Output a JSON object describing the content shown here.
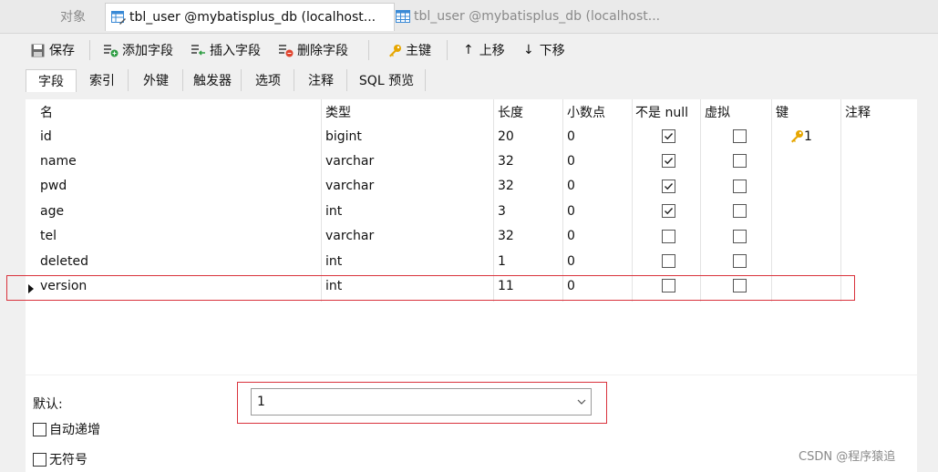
{
  "window_tabs": [
    {
      "label": "对象"
    },
    {
      "label": "tbl_user @mybatisplus_db (localhost..."
    },
    {
      "label": "tbl_user @mybatisplus_db (localhost..."
    }
  ],
  "toolbar": {
    "save": "保存",
    "add_field": "添加字段",
    "insert_field": "插入字段",
    "delete_field": "删除字段",
    "primary_key": "主键",
    "move_up": "上移",
    "move_down": "下移"
  },
  "sub_tabs": [
    "字段",
    "索引",
    "外键",
    "触发器",
    "选项",
    "注释",
    "SQL 预览"
  ],
  "columns": [
    "名",
    "类型",
    "长度",
    "小数点",
    "不是 null",
    "虚拟",
    "键",
    "注释"
  ],
  "rows": [
    {
      "name": "id",
      "type": "bigint",
      "length": "20",
      "decimals": "0",
      "not_null": true,
      "virtual": false,
      "key": "1"
    },
    {
      "name": "name",
      "type": "varchar",
      "length": "32",
      "decimals": "0",
      "not_null": true,
      "virtual": false,
      "key": ""
    },
    {
      "name": "pwd",
      "type": "varchar",
      "length": "32",
      "decimals": "0",
      "not_null": true,
      "virtual": false,
      "key": ""
    },
    {
      "name": "age",
      "type": "int",
      "length": "3",
      "decimals": "0",
      "not_null": true,
      "virtual": false,
      "key": ""
    },
    {
      "name": "tel",
      "type": "varchar",
      "length": "32",
      "decimals": "0",
      "not_null": false,
      "virtual": false,
      "key": ""
    },
    {
      "name": "deleted",
      "type": "int",
      "length": "1",
      "decimals": "0",
      "not_null": false,
      "virtual": false,
      "key": ""
    },
    {
      "name": "version",
      "type": "int",
      "length": "11",
      "decimals": "0",
      "not_null": false,
      "virtual": false,
      "key": ""
    }
  ],
  "selected_row_index": 6,
  "properties": {
    "default_label": "默认:",
    "default_value": "1",
    "auto_increment_label": "自动递增",
    "unsigned_label": "无符号"
  },
  "watermark": "CSDN @程序猿追",
  "colors": {
    "highlight_border": "#d9323c",
    "key_icon": "#e6a600",
    "table_icon": "#3a8ad6"
  }
}
